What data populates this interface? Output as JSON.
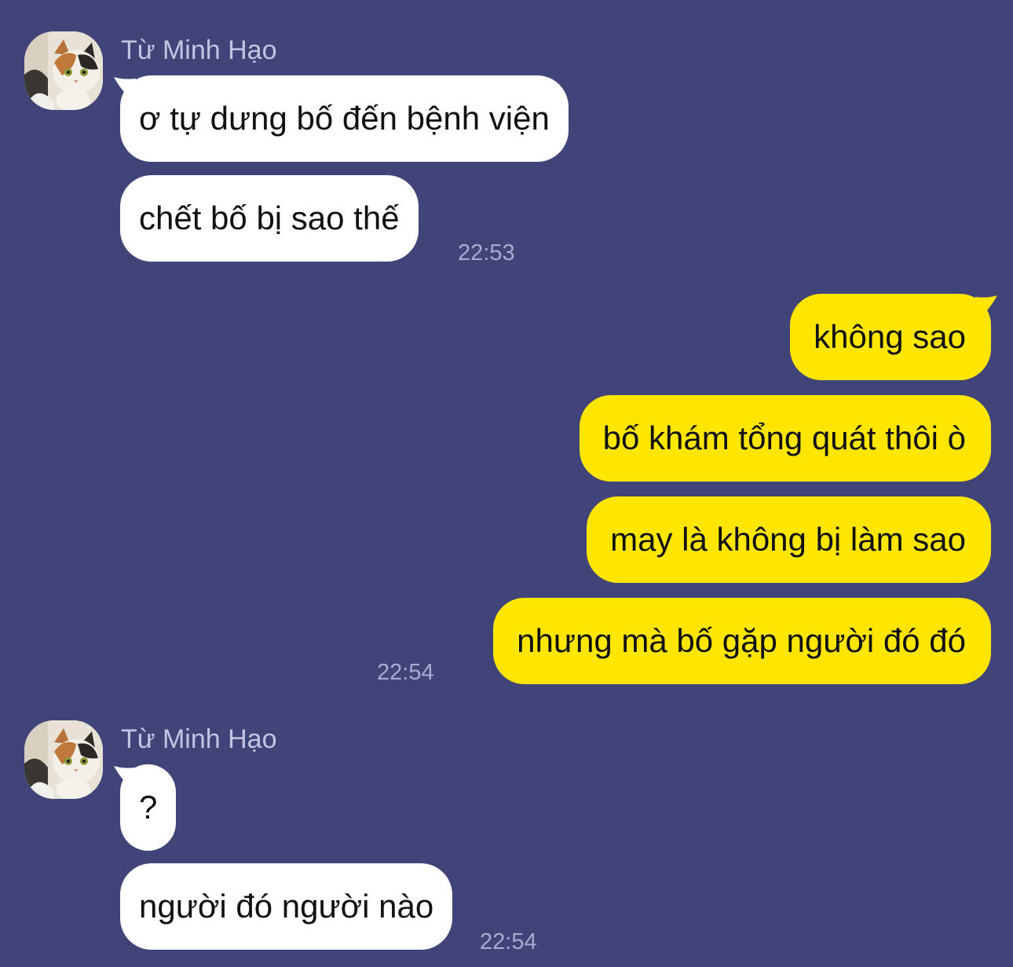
{
  "colors": {
    "background": "#414478",
    "incoming_bubble": "#ffffff",
    "outgoing_bubble": "#ffe600",
    "name_text": "#c3c5e2",
    "time_text": "#a8abd0"
  },
  "groups": [
    {
      "direction": "incoming",
      "sender": "Từ Minh Hạo",
      "avatar_icon": "calico-cat-avatar-icon",
      "messages": [
        "ơ tự dưng bố đến bệnh viện",
        "chết bố bị sao thế"
      ],
      "time": "22:53"
    },
    {
      "direction": "outgoing",
      "messages": [
        "không sao",
        "bố khám tổng quát thôi ò",
        "may là không bị làm sao",
        "nhưng mà bố gặp người đó đó"
      ],
      "time": "22:54"
    },
    {
      "direction": "incoming",
      "sender": "Từ Minh Hạo",
      "avatar_icon": "calico-cat-avatar-icon",
      "messages": [
        "?",
        "người đó người nào"
      ],
      "time": "22:54"
    }
  ]
}
